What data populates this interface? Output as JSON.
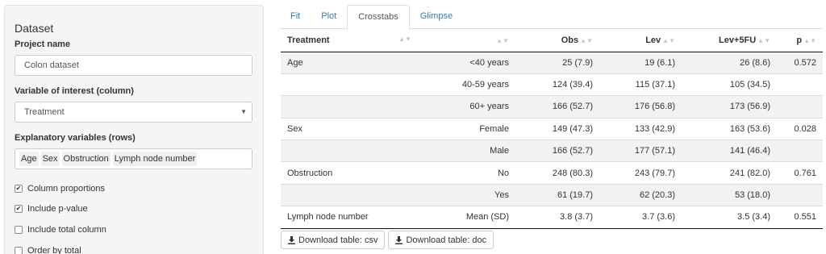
{
  "sidebar": {
    "title": "Dataset",
    "project_label": "Project name",
    "project_value": "Colon dataset",
    "variable_label": "Variable of interest (column)",
    "variable_value": "Treatment",
    "explanatory_label": "Explanatory variables (rows)",
    "explanatory_chips": [
      "Age",
      "Sex",
      "Obstruction",
      "Lymph node number"
    ],
    "checkboxes": [
      {
        "label": "Column proportions",
        "checked": true
      },
      {
        "label": "Include p-value",
        "checked": true
      },
      {
        "label": "Include total column",
        "checked": false
      },
      {
        "label": "Order by total",
        "checked": false
      }
    ]
  },
  "tabs": [
    {
      "label": "Fit",
      "active": false
    },
    {
      "label": "Plot",
      "active": false
    },
    {
      "label": "Crosstabs",
      "active": true
    },
    {
      "label": "Glimpse",
      "active": false
    }
  ],
  "table": {
    "headers": [
      "Treatment",
      "",
      "Obs",
      "Lev",
      "Lev+5FU",
      "p"
    ],
    "rows": [
      [
        "Age",
        "<40 years",
        "25 (7.9)",
        "19 (6.1)",
        "26 (8.6)",
        "0.572"
      ],
      [
        "",
        "40-59 years",
        "124 (39.4)",
        "115 (37.1)",
        "105 (34.5)",
        ""
      ],
      [
        "",
        "60+ years",
        "166 (52.7)",
        "176 (56.8)",
        "173 (56.9)",
        ""
      ],
      [
        "Sex",
        "Female",
        "149 (47.3)",
        "133 (42.9)",
        "163 (53.6)",
        "0.028"
      ],
      [
        "",
        "Male",
        "166 (52.7)",
        "177 (57.1)",
        "141 (46.4)",
        ""
      ],
      [
        "Obstruction",
        "No",
        "248 (80.3)",
        "243 (79.7)",
        "241 (82.0)",
        "0.761"
      ],
      [
        "",
        "Yes",
        "61 (19.7)",
        "62 (20.3)",
        "53 (18.0)",
        ""
      ],
      [
        "Lymph node number",
        "Mean (SD)",
        "3.8 (3.7)",
        "3.7 (3.6)",
        "3.5 (3.4)",
        "0.551"
      ]
    ]
  },
  "buttons": {
    "csv": "Download table: csv",
    "doc": "Download table: doc"
  }
}
